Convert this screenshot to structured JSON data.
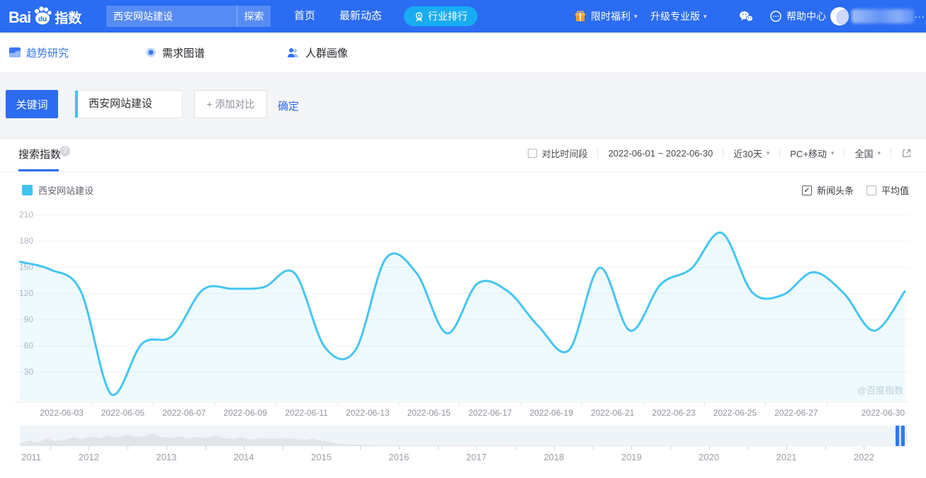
{
  "brand": {
    "bai": "Bai",
    "du": "du",
    "product": "指数"
  },
  "header": {
    "search": {
      "value": "西安网站建设",
      "submit_label": "探索"
    },
    "nav": [
      {
        "label": "首页"
      },
      {
        "label": "最新动态"
      },
      {
        "label": "行业排行"
      }
    ],
    "promo_label": "限时福利",
    "upgrade_label": "升级专业版",
    "help_label": "帮助中心",
    "user_ellipsis": "..."
  },
  "subnav": [
    {
      "label": "趋势研究",
      "active": true
    },
    {
      "label": "需求图谱",
      "active": false
    },
    {
      "label": "人群画像",
      "active": false
    }
  ],
  "keyword_bar": {
    "type_label": "关键词",
    "keyword": "西安网站建设",
    "add_label": "+ 添加对比",
    "confirm_label": "确定"
  },
  "panel": {
    "tab": "搜索指数",
    "help_glyph": "?",
    "controls": {
      "compare_label": "对比时间段",
      "date_range": "2022-06-01 ~ 2022-06-30",
      "span": "近30天",
      "device": "PC+移动",
      "region": "全国"
    },
    "legend": {
      "name": "西安网站建设",
      "color": "#3fc4f1"
    },
    "toggles": [
      {
        "label": "新闻头条",
        "checked": true
      },
      {
        "label": "平均值",
        "checked": false
      }
    ],
    "watermark": "@百度指数"
  },
  "chart_data": {
    "type": "area",
    "title": "搜索指数",
    "x": [
      "2022-06-01",
      "2022-06-02",
      "2022-06-03",
      "2022-06-04",
      "2022-06-05",
      "2022-06-06",
      "2022-06-07",
      "2022-06-08",
      "2022-06-09",
      "2022-06-10",
      "2022-06-11",
      "2022-06-12",
      "2022-06-13",
      "2022-06-14",
      "2022-06-15",
      "2022-06-16",
      "2022-06-17",
      "2022-06-18",
      "2022-06-19",
      "2022-06-20",
      "2022-06-21",
      "2022-06-22",
      "2022-06-23",
      "2022-06-24",
      "2022-06-25",
      "2022-06-26",
      "2022-06-27",
      "2022-06-28",
      "2022-06-29",
      "2022-06-30"
    ],
    "series": [
      {
        "name": "西安网站建设",
        "values": [
          156,
          147,
          122,
          4,
          62,
          71,
          124,
          125,
          127,
          143,
          58,
          55,
          160,
          143,
          74,
          131,
          122,
          82,
          55,
          149,
          77,
          130,
          148,
          189,
          121,
          118,
          144,
          120,
          77,
          122
        ]
      }
    ],
    "x_tick_labels": [
      "2022-06-03",
      "2022-06-05",
      "2022-06-07",
      "2022-06-09",
      "2022-06-11",
      "2022-06-13",
      "2022-06-15",
      "2022-06-17",
      "2022-06-19",
      "2022-06-21",
      "2022-06-23",
      "2022-06-25",
      "2022-06-27",
      "2022-06-30"
    ],
    "y_ticks": [
      30,
      60,
      90,
      120,
      150,
      180,
      210
    ],
    "ylim": [
      0,
      210
    ],
    "grid": true,
    "smooth": true,
    "legend_position": "top-left",
    "line_color": "#45c5f2",
    "area_color": "rgba(69,197,242,0.09)"
  },
  "timeline": {
    "years": [
      "2011",
      "2012",
      "2013",
      "2014",
      "2015",
      "2016",
      "2017",
      "2018",
      "2019",
      "2020",
      "2021",
      "2022"
    ],
    "shadow": [
      [
        0,
        0.12
      ],
      [
        0.01,
        0.3
      ],
      [
        0.02,
        0.2
      ],
      [
        0.03,
        0.42
      ],
      [
        0.04,
        0.28
      ],
      [
        0.05,
        0.35
      ],
      [
        0.06,
        0.48
      ],
      [
        0.07,
        0.38
      ],
      [
        0.08,
        0.52
      ],
      [
        0.09,
        0.42
      ],
      [
        0.1,
        0.58
      ],
      [
        0.11,
        0.46
      ],
      [
        0.12,
        0.62
      ],
      [
        0.13,
        0.5
      ],
      [
        0.14,
        0.55
      ],
      [
        0.15,
        0.68
      ],
      [
        0.16,
        0.48
      ],
      [
        0.17,
        0.44
      ],
      [
        0.18,
        0.54
      ],
      [
        0.19,
        0.4
      ],
      [
        0.2,
        0.5
      ],
      [
        0.21,
        0.44
      ],
      [
        0.22,
        0.58
      ],
      [
        0.23,
        0.44
      ],
      [
        0.24,
        0.38
      ],
      [
        0.25,
        0.48
      ],
      [
        0.26,
        0.34
      ],
      [
        0.27,
        0.44
      ],
      [
        0.28,
        0.38
      ],
      [
        0.3,
        0.44
      ],
      [
        0.32,
        0.34
      ],
      [
        0.33,
        0.4
      ],
      [
        0.35,
        0.22
      ],
      [
        0.36,
        0.12
      ],
      [
        0.38,
        0.08
      ],
      [
        0.42,
        0.05
      ],
      [
        0.5,
        0.04
      ],
      [
        0.6,
        0.03
      ],
      [
        0.7,
        0.03
      ],
      [
        0.8,
        0.02
      ],
      [
        0.9,
        0.02
      ],
      [
        1,
        0.02
      ]
    ],
    "handle_color": "#2e79f3"
  }
}
